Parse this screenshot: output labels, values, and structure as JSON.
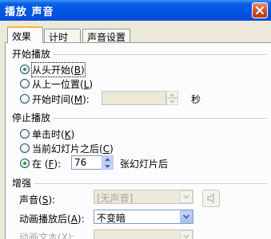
{
  "window": {
    "title": "播放 声音"
  },
  "tabs": [
    {
      "label": "效果",
      "active": true
    },
    {
      "label": "计时",
      "active": false
    },
    {
      "label": "声音设置",
      "active": false
    }
  ],
  "start_play": {
    "title": "开始播放",
    "options": [
      {
        "label": "从头开始",
        "key": "B",
        "selected": true
      },
      {
        "label": "从上一位置",
        "key": "L",
        "selected": false
      },
      {
        "label": "开始时间",
        "key": "M",
        "selected": false
      }
    ],
    "time_value": "",
    "time_unit": "秒"
  },
  "stop_play": {
    "title": "停止播放",
    "options": [
      {
        "label": "单击时",
        "key": "K",
        "selected": false
      },
      {
        "label": "当前幻灯片之后",
        "key": "C",
        "selected": false
      },
      {
        "label": "在",
        "key": "F",
        "selected": true
      }
    ],
    "slides_value": "76",
    "slides_suffix": "张幻灯片后"
  },
  "enhance": {
    "title": "增强",
    "sound_label": "声音",
    "sound_key": "S",
    "sound_value": "[无声音]",
    "after_anim_label": "动画播放后",
    "after_anim_key": "A",
    "after_anim_value": "不变暗",
    "anim_text_label": "动画文本",
    "anim_text_key": "X"
  },
  "icons": {
    "close": "close-icon",
    "speaker": "speaker-icon",
    "spin_up": "spin-up-icon",
    "spin_down": "spin-down-icon",
    "dropdown": "chevron-down-icon"
  },
  "colors": {
    "titlebar": "#0054e3",
    "tab_highlight": "#f8b33a",
    "radio_dot": "#21a121",
    "dialog_bg": "#ece9d8"
  }
}
